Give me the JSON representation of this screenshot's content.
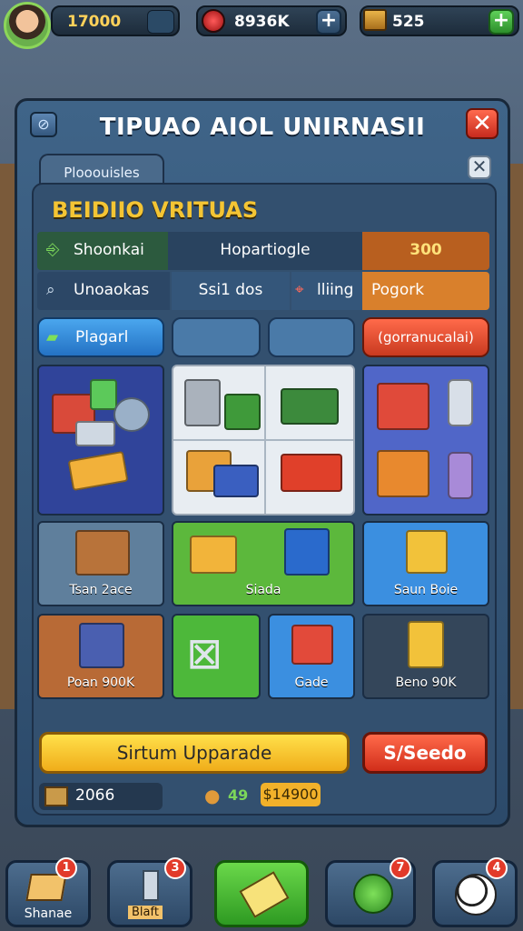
{
  "hud": {
    "cash": "17000",
    "gems": "8936K",
    "stock": "525",
    "plus": "+"
  },
  "panel": {
    "title": "TIPUAO AIOL UNIRNASII",
    "close": "✕",
    "help": "⊘",
    "tab_label": "Plooouisles",
    "tab_close": "✕",
    "subtitle": "BEIDIIO VRITUAS"
  },
  "info_rows": {
    "row1": {
      "c1": "Shoonkai",
      "c2": "Hopartiogle",
      "c3": "300"
    },
    "row2": {
      "c1": "Unoaokas",
      "c2": "Ssi1 dos",
      "c3": "lliing",
      "c4": "Pogork"
    }
  },
  "actions": {
    "placard": "Plagarl",
    "gormanual": "(gorranucalai)"
  },
  "tiles": {
    "t1": "Tsan 2ace",
    "t2": "Siada",
    "t3": "Saun Boie",
    "t4": "Poan 900K",
    "t5": "Gade",
    "t6": "Beno 90K"
  },
  "buttons": {
    "upgrade": "Sirtum Upparade",
    "sell": "S/Seedo"
  },
  "footer": {
    "boxes": "2066",
    "mid": "49",
    "price": "$14900"
  },
  "nav": {
    "n1": "Shanae",
    "n2": "Blaft",
    "badge1": "1",
    "badge2": "3",
    "badge4": "7",
    "badge5": "4"
  },
  "colors": {
    "accent_yellow": "#f4c534",
    "accent_orange": "#e08a2a",
    "accent_red": "#e24a2a",
    "accent_green": "#58c23a",
    "accent_blue": "#3b8fe0"
  }
}
